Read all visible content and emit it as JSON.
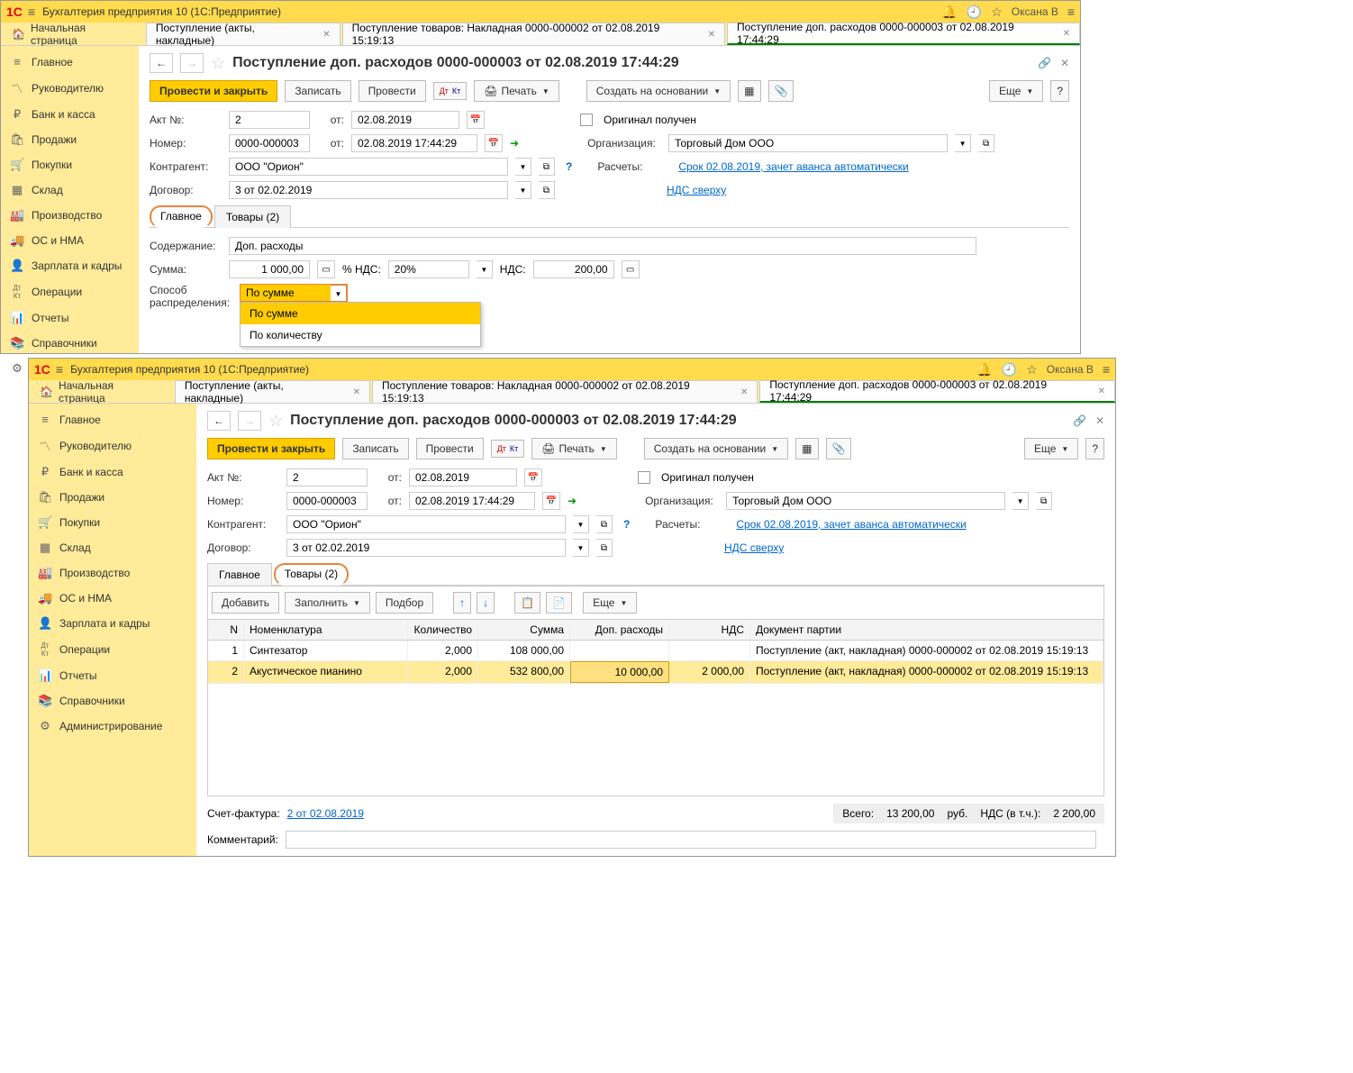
{
  "app": {
    "logo": "1С",
    "title": "Бухгалтерия предприятия 10  (1С:Предприятие)",
    "user": "Оксана В"
  },
  "home_tab": "Начальная страница",
  "tabs": {
    "t1": "Поступление (акты, накладные)",
    "t2": "Поступление товаров: Накладная 0000-000002 от 02.08.2019 15:19:13",
    "t3": "Поступление доп. расходов 0000-000003 от 02.08.2019 17:44:29"
  },
  "sidebar": {
    "items": [
      {
        "icon": "≡",
        "label": "Главное"
      },
      {
        "icon": "〽",
        "label": "Руководителю"
      },
      {
        "icon": "₽",
        "label": "Банк и касса"
      },
      {
        "icon": "🛍",
        "label": "Продажи"
      },
      {
        "icon": "🛒",
        "label": "Покупки"
      },
      {
        "icon": "▦",
        "label": "Склад"
      },
      {
        "icon": "🏭",
        "label": "Производство"
      },
      {
        "icon": "🚚",
        "label": "ОС и НМА"
      },
      {
        "icon": "👤",
        "label": "Зарплата и кадры"
      },
      {
        "icon": "Дт Кт",
        "label": "Операции"
      },
      {
        "icon": "📊",
        "label": "Отчеты"
      },
      {
        "icon": "📚",
        "label": "Справочники"
      },
      {
        "icon": "⚙",
        "label": "Администрирование"
      }
    ]
  },
  "doc": {
    "title": "Поступление доп. расходов 0000-000003 от 02.08.2019 17:44:29",
    "buttons": {
      "post_close": "Провести и закрыть",
      "write": "Записать",
      "post": "Провести",
      "print": "Печать",
      "create_based": "Создать на основании",
      "more": "Еще"
    },
    "labels": {
      "act_no": "Акт №:",
      "ot": "от:",
      "number": "Номер:",
      "contragent": "Контрагент:",
      "contract": "Договор:",
      "original": "Оригинал получен",
      "org": "Организация:",
      "raschet": "Расчеты:",
      "content": "Содержание:",
      "sum": "Сумма:",
      "nds_pct": "% НДС:",
      "nds": "НДС:",
      "distrib": "Способ распределения:",
      "invoice": "Счет-фактура:",
      "comment": "Комментарий:",
      "total": "Всего:",
      "rub": "руб.",
      "nds_incl": "НДС (в т.ч.):"
    },
    "values": {
      "act_no": "2",
      "act_date": "02.08.2019",
      "number": "0000-000003",
      "num_date": "02.08.2019 17:44:29",
      "contragent": "ООО \"Орион\"",
      "contract": "3 от 02.02.2019",
      "org": "Торговый Дом ООО",
      "raschet_link": "Срок 02.08.2019, зачет аванса автоматически",
      "nds_link": "НДС сверху",
      "content": "Доп. расходы",
      "sum": "1 000,00",
      "nds_pct": "20%",
      "nds": "200,00",
      "distrib": "По сумме",
      "invoice_link": "2 от 02.08.2019",
      "total": "13 200,00",
      "nds_total": "2 200,00"
    },
    "distrib_options": [
      "По сумме",
      "По количеству"
    ]
  },
  "subtabs": {
    "main": "Главное",
    "goods": "Товары (2)"
  },
  "goods_toolbar": {
    "add": "Добавить",
    "fill": "Заполнить",
    "pick": "Подбор",
    "more": "Еще"
  },
  "grid": {
    "headers": {
      "n": "N",
      "nom": "Номенклатура",
      "qty": "Количество",
      "sum": "Сумма",
      "dop": "Доп. расходы",
      "nds": "НДС",
      "doc": "Документ партии"
    },
    "rows": [
      {
        "n": "1",
        "nom": "Синтезатор",
        "qty": "2,000",
        "sum": "108 000,00",
        "dop": "",
        "nds": "",
        "doc": "Поступление (акт, накладная) 0000-000002 от 02.08.2019 15:19:13"
      },
      {
        "n": "2",
        "nom": "Акустическое пианино",
        "qty": "2,000",
        "sum": "532 800,00",
        "dop": "10 000,00",
        "nds": "2 000,00",
        "doc": "Поступление (акт, накладная) 0000-000002 от 02.08.2019 15:19:13"
      }
    ]
  }
}
